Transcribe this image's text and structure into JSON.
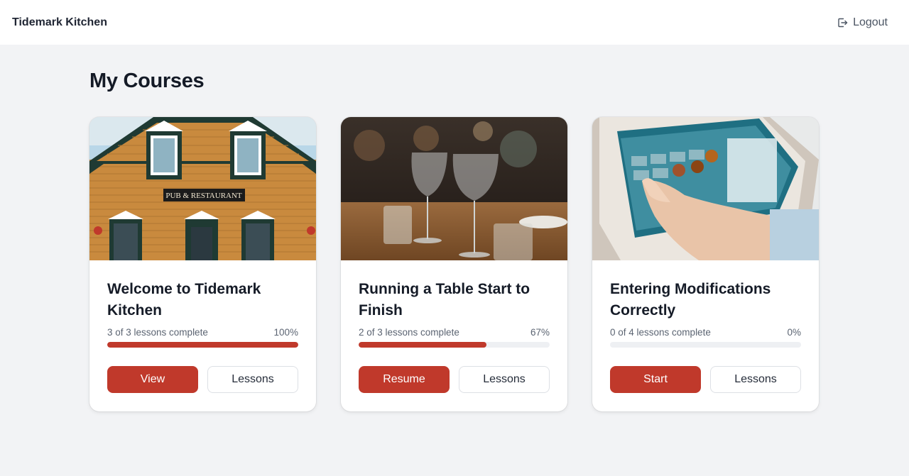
{
  "app": {
    "brand": "Tidemark Kitchen"
  },
  "header": {
    "logout_label": "Logout",
    "logout_icon": "logout-icon"
  },
  "page": {
    "title": "My Courses"
  },
  "colors": {
    "accent": "#c0392b",
    "background": "#f2f3f5",
    "track": "#eef0f3"
  },
  "courses": [
    {
      "title": "Welcome to Tidemark Kitchen",
      "progress_text": "3 of 3 lessons complete",
      "percent_label": "100%",
      "percent": 100,
      "primary_label": "View",
      "secondary_label": "Lessons",
      "image": "pub-restaurant-building",
      "sign_text": "PUB & RESTAURANT"
    },
    {
      "title": "Running a Table Start to Finish",
      "progress_text": "2 of 3 lessons complete",
      "percent_label": "67%",
      "percent": 67,
      "primary_label": "Resume",
      "secondary_label": "Lessons",
      "image": "wine-glasses-table"
    },
    {
      "title": "Entering Modifications Correctly",
      "progress_text": "0 of 4 lessons complete",
      "percent_label": "0%",
      "percent": 0,
      "primary_label": "Start",
      "secondary_label": "Lessons",
      "image": "pos-tablet-touch"
    }
  ]
}
